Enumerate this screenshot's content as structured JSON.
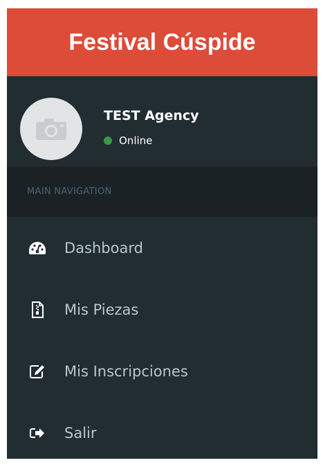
{
  "brand": {
    "title": "Festival Cúspide"
  },
  "user": {
    "name": "TEST Agency",
    "status": "Online",
    "status_color": "#3c9a48"
  },
  "nav": {
    "header": "MAIN NAVIGATION",
    "items": [
      {
        "label": "Dashboard",
        "icon": "dashboard-icon"
      },
      {
        "label": "Mis Piezas",
        "icon": "file-icon"
      },
      {
        "label": "Mis Inscripciones",
        "icon": "edit-icon"
      },
      {
        "label": "Salir",
        "icon": "sign-out-icon"
      }
    ]
  },
  "colors": {
    "brand_bg": "#dd4b39",
    "sidebar_bg": "#222d32",
    "header_bg": "#1a2226",
    "nav_text": "#b8c7ce"
  }
}
